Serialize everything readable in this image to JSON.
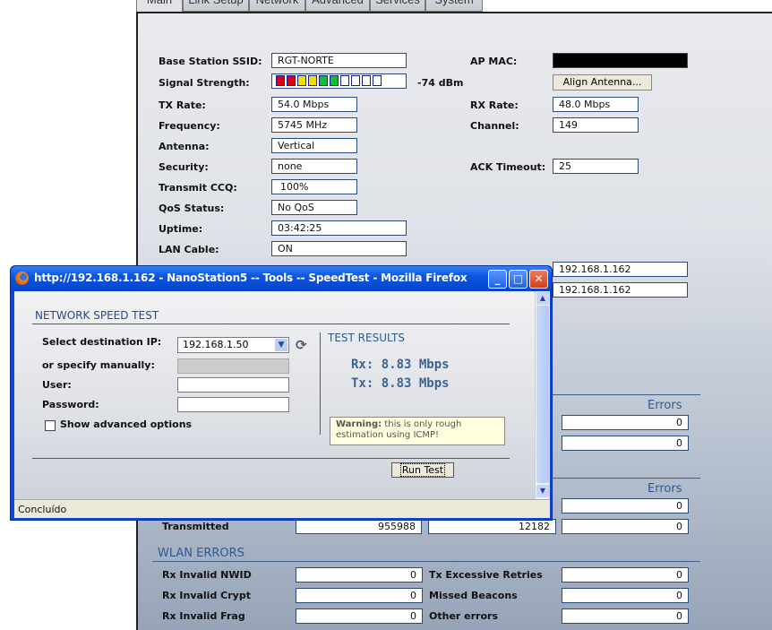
{
  "tabs": [
    "Main",
    "Link Setup",
    "Network",
    "Advanced",
    "Services",
    "System"
  ],
  "main": {
    "ssid_label": "Base Station SSID:",
    "ssid": "RGT-NORTE",
    "signal_label": "Signal Strength:",
    "signal_bars_lit": 6,
    "signal_bars_total": 10,
    "signal_dbm": "-74 dBm",
    "ap_mac_label": "AP MAC:",
    "align_button": "Align Antenna...",
    "tx_rate_label": "TX Rate:",
    "tx_rate": "54.0 Mbps",
    "rx_rate_label": "RX Rate:",
    "rx_rate": "48.0 Mbps",
    "freq_label": "Frequency:",
    "freq": "5745 MHz",
    "channel_label": "Channel:",
    "channel": "149",
    "antenna_label": "Antenna:",
    "antenna": "Vertical",
    "security_label": "Security:",
    "security": "none",
    "ack_label": "ACK Timeout:",
    "ack": "25",
    "ccq_label": "Transmit CCQ:",
    "ccq": "100%",
    "qos_label": "QoS Status:",
    "qos": "No QoS",
    "uptime_label": "Uptime:",
    "uptime": "03:42:25",
    "lan_label": "LAN Cable:",
    "lan": "ON",
    "ip1": "192.168.1.162",
    "ip2": "192.168.1.162"
  },
  "stats": {
    "errors_header_1": "Errors",
    "errors_1": [
      "0",
      "0"
    ],
    "errors_header_2": "Errors",
    "errors_2": "0",
    "transmitted_label": "Transmitted",
    "transmitted": [
      "955988",
      "12182",
      "0"
    ]
  },
  "wlan_errors": {
    "title": "WLAN ERRORS",
    "rows": [
      {
        "l1": "Rx Invalid NWID",
        "v1": "0",
        "l2": "Tx Excessive Retries",
        "v2": "0"
      },
      {
        "l1": "Rx Invalid Crypt",
        "v1": "0",
        "l2": "Missed Beacons",
        "v2": "0"
      },
      {
        "l1": "Rx Invalid Frag",
        "v1": "0",
        "l2": "Other errors",
        "v2": "0"
      }
    ]
  },
  "popup": {
    "title": "http://192.168.1.162 - NanoStation5 -- Tools -- SpeedTest - Mozilla Firefox",
    "heading": "NETWORK SPEED TEST",
    "dest_label": "Select destination IP:",
    "dest_value": "192.168.1.50",
    "manual_label": "or specify manually:",
    "user_label": "User:",
    "password_label": "Password:",
    "advanced_label": "Show advanced options",
    "results_heading": "TEST RESULTS",
    "rx": "Rx: 8.83 Mbps",
    "tx": "Tx: 8.83 Mbps",
    "warning_bold": "Warning:",
    "warning_text": " this is only rough estimation using ICMP!",
    "run_button": "Run Test",
    "status": "Concluído"
  },
  "colors": {
    "accent": "#2a5a94",
    "titlebar": "#0a55e0"
  }
}
